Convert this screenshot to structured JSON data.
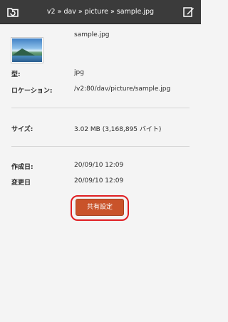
{
  "header": {
    "path_title": "v2 » dav » picture » sample.jpg",
    "back_icon": "back-folder-icon",
    "edit_icon": "edit-icon"
  },
  "file": {
    "thumbnail_icon": "image-thumbnail",
    "name": "sample.jpg"
  },
  "details": {
    "type_label": "型:",
    "type_value": "jpg",
    "location_label": "ロケーション:",
    "location_value": "/v2:80/dav/picture/sample.jpg",
    "size_label": "サイズ:",
    "size_value": "3.02 MB (3,168,895 バイト)",
    "created_label": "作成日:",
    "created_value": "20/09/10 12:09",
    "modified_label": "変更日",
    "modified_value": "20/09/10 12:09"
  },
  "actions": {
    "share_label": "共有設定"
  },
  "colors": {
    "header_bg": "#3b3b3b",
    "panel_bg": "#f4f4f4",
    "share_button": "#c9532a",
    "highlight_ring": "#e01e22"
  }
}
